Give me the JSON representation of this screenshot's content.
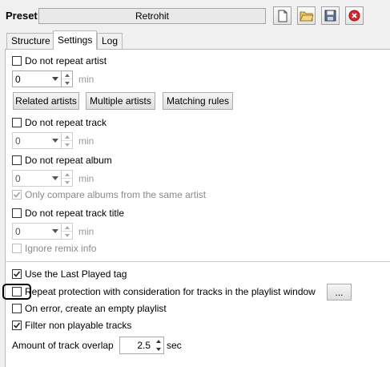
{
  "preset": {
    "label": "Preset",
    "name": "Retrohit",
    "toolbar": [
      {
        "name": "new-file-icon"
      },
      {
        "name": "open-folder-icon"
      },
      {
        "name": "save-icon"
      },
      {
        "name": "delete-icon"
      }
    ]
  },
  "tabs": [
    {
      "label": "Structure",
      "active": false
    },
    {
      "label": "Settings",
      "active": true
    },
    {
      "label": "Log",
      "active": false
    }
  ],
  "settings": {
    "artist": {
      "checkbox_label": "Do not repeat artist",
      "checked": false,
      "value": "0",
      "unit": "min",
      "buttons": [
        "Related artists",
        "Multiple artists",
        "Matching rules"
      ]
    },
    "track": {
      "checkbox_label": "Do not repeat track",
      "checked": false,
      "value": "0",
      "unit": "min"
    },
    "album": {
      "checkbox_label": "Do not repeat album",
      "checked": false,
      "value": "0",
      "unit": "min",
      "sub_label": "Only compare albums from the same artist",
      "sub_checked": true
    },
    "title": {
      "checkbox_label": "Do not repeat track title",
      "checked": false,
      "value": "0",
      "unit": "min",
      "sub_label": "Ignore remix info",
      "sub_checked": false
    },
    "last_played": {
      "label": "Use the Last Played tag",
      "checked": true
    },
    "repeat_protection": {
      "label": "Repeat protection with consideration for tracks in the playlist window",
      "checked": false,
      "button": "..."
    },
    "on_error": {
      "label": "On error, create an empty playlist",
      "checked": false
    },
    "filter": {
      "label": "Filter non playable tracks",
      "checked": true
    },
    "overlap": {
      "label": "Amount of track overlap",
      "value": "2.5",
      "unit": "sec"
    }
  }
}
